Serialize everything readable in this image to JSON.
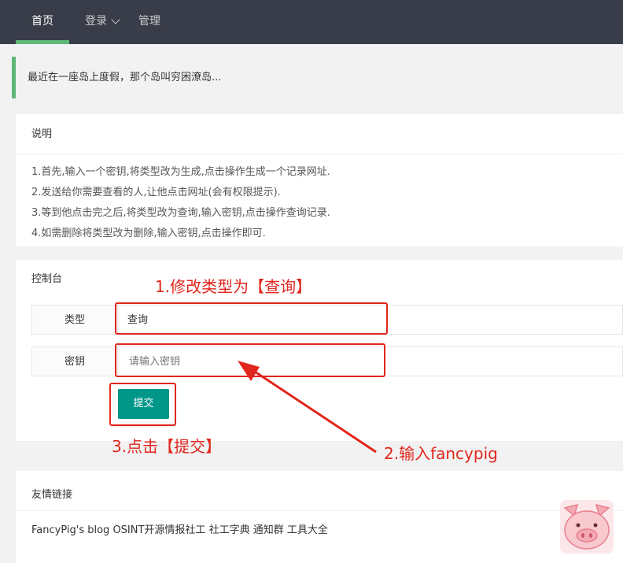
{
  "nav": {
    "items": [
      {
        "label": "首页",
        "active": true
      },
      {
        "label": "登录",
        "has_dropdown": true
      },
      {
        "label": "管理"
      }
    ],
    "accent_color": "#5fb878"
  },
  "quote": {
    "text": "最近在一座岛上度假，那个岛叫穷困潦岛..."
  },
  "instructions": {
    "title": "说明",
    "lines": [
      "1.首先,输入一个密钥,将类型改为生成,点击操作生成一个记录网址.",
      "2.发送给你需要查看的人,让他点击网址(会有权限提示).",
      "3.等到他点击完之后,将类型改为查询,输入密钥,点击操作查询记录.",
      "4.如需删除将类型改为删除,输入密钥,点击操作即可."
    ]
  },
  "console": {
    "title": "控制台",
    "type_label": "类型",
    "type_value": "查询",
    "key_label": "密钥",
    "key_placeholder": "请输入密钥",
    "key_value": "",
    "submit_label": "提交",
    "submit_color": "#009688"
  },
  "annotations": {
    "step1": "1.修改类型为【查询】",
    "step2": "2.输入fancypig",
    "step3": "3.点击【提交】",
    "color": "#e0261d"
  },
  "links": {
    "title": "友情链接",
    "items": [
      "FancyPig's blog",
      "OSINT开源情报社工",
      "社工字典",
      "通知群",
      "工具大全"
    ]
  },
  "watermark": {
    "icon": "pig-face-icon"
  }
}
